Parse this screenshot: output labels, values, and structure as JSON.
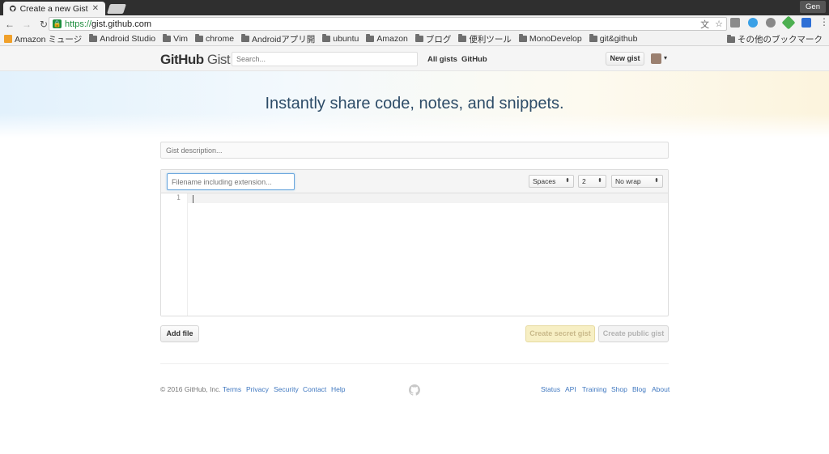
{
  "browser": {
    "tab_title": "Create a new Gist",
    "tab_close": "✕",
    "user_badge": "Gen",
    "url_protocol": "https://",
    "url_host": "gist.github.com",
    "bookmarks": [
      {
        "label": "Amazon ミュージ",
        "icon": "amazon-icon"
      },
      {
        "label": "Android Studio",
        "icon": "folder-icon"
      },
      {
        "label": "Vim",
        "icon": "folder-icon"
      },
      {
        "label": "chrome",
        "icon": "folder-icon"
      },
      {
        "label": "Androidアプリ開",
        "icon": "folder-icon"
      },
      {
        "label": "ubuntu",
        "icon": "folder-icon"
      },
      {
        "label": "Amazon",
        "icon": "folder-icon"
      },
      {
        "label": "ブログ",
        "icon": "folder-icon"
      },
      {
        "label": "便利ツール",
        "icon": "folder-icon"
      },
      {
        "label": "MonoDevelop",
        "icon": "folder-icon"
      },
      {
        "label": "git&github",
        "icon": "folder-icon"
      }
    ],
    "other_bookmarks": "その他のブックマーク"
  },
  "header": {
    "logo_bold": "GitHub",
    "logo_light": " Gist",
    "search_placeholder": "Search...",
    "nav_all_gists": "All gists",
    "nav_github": "GitHub",
    "new_gist": "New gist"
  },
  "hero": {
    "title": "Instantly share code, notes, and snippets."
  },
  "form": {
    "description_placeholder": "Gist description...",
    "filename_placeholder": "Filename including extension...",
    "indent_mode": "Spaces",
    "indent_size": "2",
    "wrap_mode": "No wrap",
    "line_number": "1",
    "add_file": "Add file",
    "create_secret": "Create secret gist",
    "create_public": "Create public gist"
  },
  "footer": {
    "copyright": "© 2016 GitHub, Inc.",
    "left_links": [
      "Terms",
      "Privacy",
      "Security",
      "Contact",
      "Help"
    ],
    "right_links": [
      "Status",
      "API",
      "Training",
      "Shop",
      "Blog",
      "About"
    ]
  },
  "colors": {
    "link": "#4078c0",
    "hero_text": "#2d4c68",
    "secret_button_bg": "#f7efc4"
  }
}
